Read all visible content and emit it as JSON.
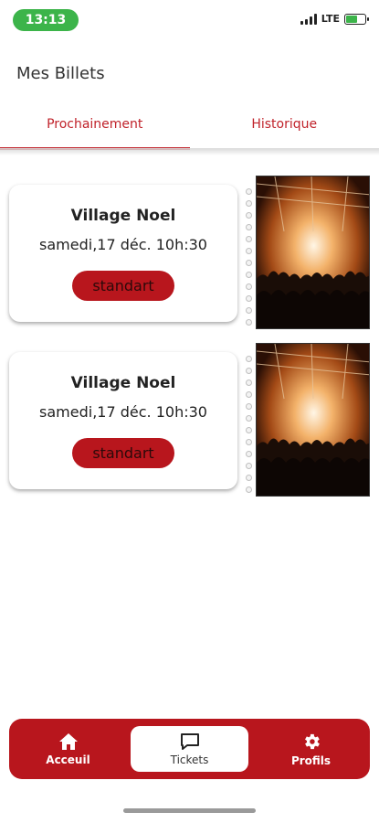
{
  "status_bar": {
    "time": "13:13",
    "network": "LTE",
    "battery_icon": "battery-charging-icon",
    "signal_icon": "signal-bars-icon"
  },
  "page": {
    "title": "Mes Billets"
  },
  "tabs": [
    {
      "label": "Prochainement",
      "active": true
    },
    {
      "label": "Historique",
      "active": false
    }
  ],
  "tickets": [
    {
      "event_name": "Village Noel",
      "date": "samedi,17 déc. 10h:30",
      "type": "standart",
      "image_icon": "concert-crowd-image"
    },
    {
      "event_name": "Village Noel",
      "date": "samedi,17 déc. 10h:30",
      "type": "standart",
      "image_icon": "concert-crowd-image"
    }
  ],
  "bottom_nav": [
    {
      "label": "Acceuil",
      "icon": "home-icon",
      "active": false
    },
    {
      "label": "Tickets",
      "icon": "chat-bubble-icon",
      "active": true
    },
    {
      "label": "Profils",
      "icon": "gear-icon",
      "active": false
    }
  ],
  "colors": {
    "accent": "#b8161d",
    "tab_text": "#c0222a",
    "time_pill": "#3cb44a"
  }
}
